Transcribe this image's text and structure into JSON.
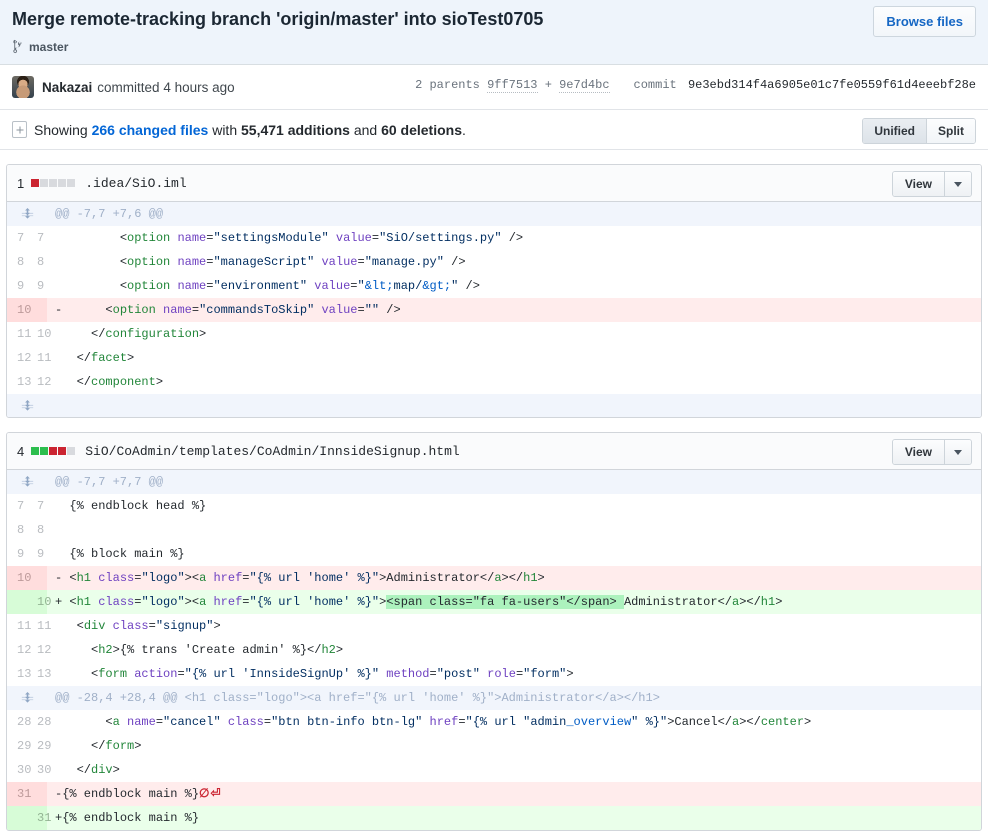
{
  "commit": {
    "title": "Merge remote-tracking branch 'origin/master' into sioTest0705",
    "branch": "master",
    "browse_files_label": "Browse files",
    "author": "Nakazai",
    "committed_text": "committed 4 hours ago",
    "parents_label": "2 parents",
    "parent_1": "9ff7513",
    "parent_plus": "+",
    "parent_2": "9e7d4bc",
    "commit_label": "commit",
    "commit_sha": "9e3ebd314f4a6905e01c7fe0559f61d4eeebf28e"
  },
  "stats": {
    "showing": "Showing",
    "changed_files": "266 changed files",
    "with": "with",
    "additions": "55,471 additions",
    "and": "and",
    "deletions": "60 deletions",
    "period": ".",
    "unified_label": "Unified",
    "split_label": "Split"
  },
  "colors": {
    "addition": "#2cbe4e",
    "deletion": "#cb2431",
    "link": "#0366d6",
    "header_bg": "#eef4fb"
  },
  "files": [
    {
      "change_count": "1",
      "path": ".idea/SiO.iml",
      "diffstat": [
        "del",
        "non",
        "non",
        "non",
        "non"
      ],
      "view_label": "View",
      "hunks": [
        {
          "header": "@@ -7,7 +7,6 @@",
          "lines": [
            {
              "type": "ctx",
              "old": "7",
              "new": "7",
              "sign": "",
              "html": "        &lt;<span class='t'>option</span> <span class='a'>name</span>=<span class='s'>\"settingsModule\"</span> <span class='a'>value</span>=<span class='s'>\"SiO/settings.py\"</span> /&gt;"
            },
            {
              "type": "ctx",
              "old": "8",
              "new": "8",
              "sign": "",
              "html": "        &lt;<span class='t'>option</span> <span class='a'>name</span>=<span class='s'>\"manageScript\"</span> <span class='a'>value</span>=<span class='s'>\"manage.py\"</span> /&gt;"
            },
            {
              "type": "ctx",
              "old": "9",
              "new": "9",
              "sign": "",
              "html": "        &lt;<span class='t'>option</span> <span class='a'>name</span>=<span class='s'>\"environment\"</span> <span class='a'>value</span>=<span class='s'>\"<span class='e'>&amp;lt;</span>map/<span class='e'>&amp;gt;</span>\"</span> /&gt;"
            },
            {
              "type": "del",
              "old": "10",
              "new": "",
              "sign": "-",
              "html": "      &lt;<span class='t'>option</span> <span class='a'>name</span>=<span class='s'>\"commandsToSkip\"</span> <span class='a'>value</span>=<span class='s'>\"\"</span> /&gt;"
            },
            {
              "type": "ctx",
              "old": "11",
              "new": "10",
              "sign": "",
              "html": "    &lt;/<span class='t'>configuration</span>&gt;"
            },
            {
              "type": "ctx",
              "old": "12",
              "new": "11",
              "sign": "",
              "html": "  &lt;/<span class='t'>facet</span>&gt;"
            },
            {
              "type": "ctx",
              "old": "13",
              "new": "12",
              "sign": "",
              "html": "  &lt;/<span class='t'>component</span>&gt;"
            }
          ],
          "trailing_expand": true
        }
      ]
    },
    {
      "change_count": "4",
      "path": "SiO/CoAdmin/templates/CoAdmin/InnsideSignup.html",
      "diffstat": [
        "add",
        "add",
        "del",
        "del",
        "non"
      ],
      "view_label": "View",
      "hunks": [
        {
          "header": "@@ -7,7 +7,7 @@",
          "lines": [
            {
              "type": "ctx",
              "old": "7",
              "new": "7",
              "sign": "",
              "html": " {% endblock head %}"
            },
            {
              "type": "ctx",
              "old": "8",
              "new": "8",
              "sign": "",
              "html": " "
            },
            {
              "type": "ctx",
              "old": "9",
              "new": "9",
              "sign": "",
              "html": " {% block main %}"
            },
            {
              "type": "del",
              "old": "10",
              "new": "",
              "sign": "-",
              "html": " &lt;<span class='t'>h1</span> <span class='a'>class</span>=<span class='s'>\"logo\"</span>&gt;&lt;<span class='t'>a</span> <span class='a'>href</span>=<span class='s'>\"{% url 'home' %}\"</span>&gt;Administrator&lt;/<span class='t'>a</span>&gt;&lt;/<span class='t'>h1</span>&gt;"
            },
            {
              "type": "add",
              "old": "",
              "new": "10",
              "sign": "+",
              "html": " &lt;<span class='t'>h1</span> <span class='a'>class</span>=<span class='s'>\"logo\"</span>&gt;&lt;<span class='t'>a</span> <span class='a'>href</span>=<span class='s'>\"{% url 'home' %}\"</span>&gt;<span class='wordhl-add'>&lt;span class=\"fa fa-users\"&lt;/span&gt; </span>Administrator&lt;/<span class='t'>a</span>&gt;&lt;/<span class='t'>h1</span>&gt;"
            },
            {
              "type": "ctx",
              "old": "11",
              "new": "11",
              "sign": "",
              "html": "  &lt;<span class='t'>div</span> <span class='a'>class</span>=<span class='s'>\"signup\"</span>&gt;"
            },
            {
              "type": "ctx",
              "old": "12",
              "new": "12",
              "sign": "",
              "html": "    &lt;<span class='t'>h2</span>&gt;{% trans 'Create admin' %}&lt;/<span class='t'>h2</span>&gt;"
            },
            {
              "type": "ctx",
              "old": "13",
              "new": "13",
              "sign": "",
              "html": "    &lt;<span class='t'>form</span> <span class='a'>action</span>=<span class='s'>\"{% url 'InnsideSignUp' %}\"</span> <span class='a'>method</span>=<span class='s'>\"post\"</span> <span class='a'>role</span>=<span class='s'>\"form\"</span>&gt;"
            }
          ]
        },
        {
          "header": "@@ -28,4 +28,4 @@ <h1 class=\"logo\"><a href=\"{% url 'home' %}\">Administrator</a></h1>",
          "lines": [
            {
              "type": "ctx",
              "old": "28",
              "new": "28",
              "sign": "",
              "html": "      &lt;<span class='t'>a</span> <span class='a'>name</span>=<span class='s'>\"cancel\"</span> <span class='a'>class</span>=<span class='s'>\"btn btn-info btn-lg\"</span> <span class='a'>href</span>=<span class='s'>\"{% url \"admin<span class='e'>_overview</span>\" %}\"</span>&gt;Cancel&lt;/<span class='t'>a</span>&gt;&lt;/<span class='t'>center</span>&gt;"
            },
            {
              "type": "ctx",
              "old": "29",
              "new": "29",
              "sign": "",
              "html": "    &lt;/<span class='t'>form</span>&gt;"
            },
            {
              "type": "ctx",
              "old": "30",
              "new": "30",
              "sign": "",
              "html": "  &lt;/<span class='t'>div</span>&gt;"
            },
            {
              "type": "del",
              "old": "31",
              "new": "",
              "sign": "-",
              "html": "{% endblock main %}<span class='nonewline'>&#8709;&#9166;</span>"
            },
            {
              "type": "add",
              "old": "",
              "new": "31",
              "sign": "+",
              "html": "{% endblock main %}"
            }
          ]
        }
      ]
    }
  ]
}
